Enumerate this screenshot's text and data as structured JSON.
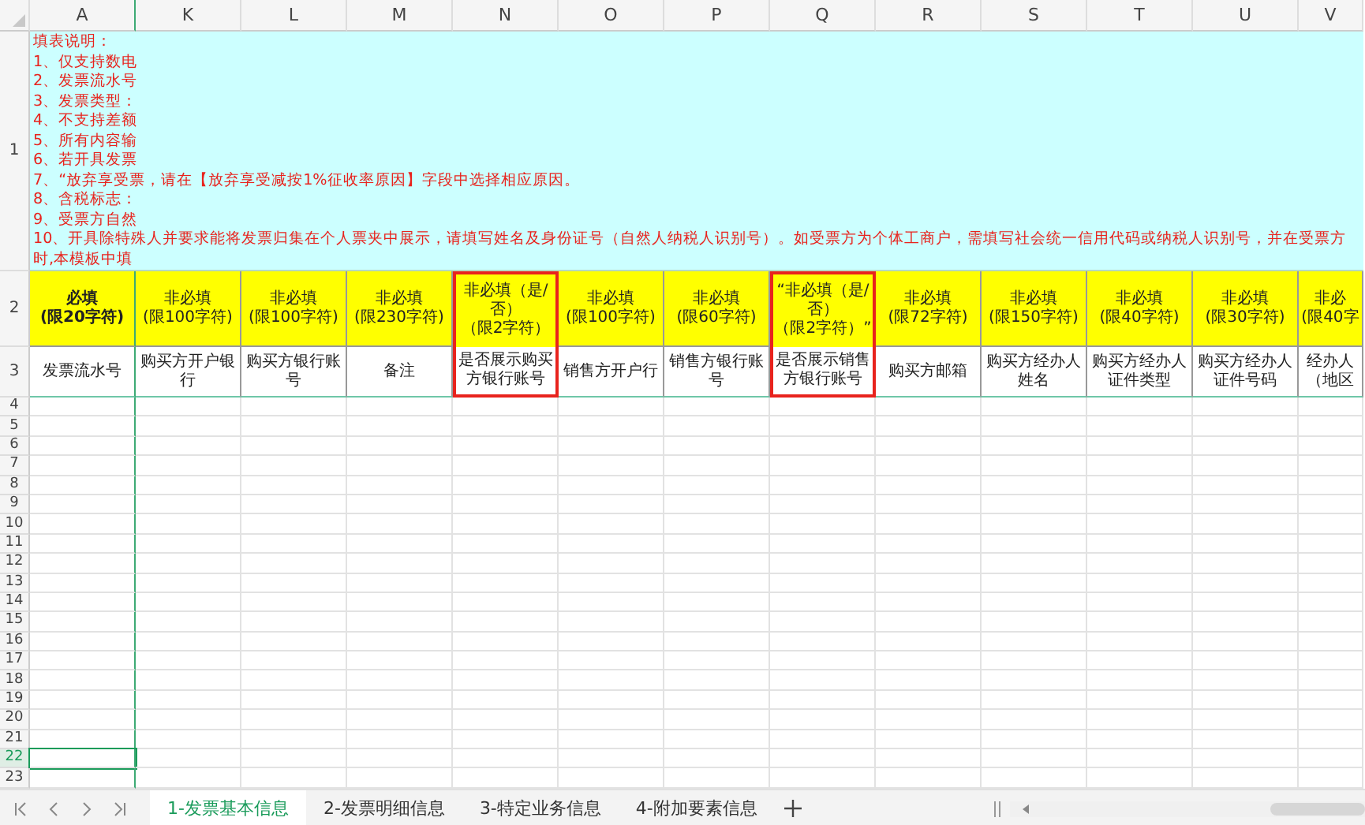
{
  "notes": {
    "title": "填表说明：",
    "lines": [
      "1、仅支持数电",
      "2、发票流水号",
      "3、发票类型：",
      "4、不支持差额",
      "5、所有内容输",
      "6、若开具发票",
      "7、“放弃享受票，请在【放弃享受减按1%征收率原因】字段中选择相应原因。",
      "8、含税标志：",
      "9、受票方自然",
      "10、开具除特殊人并要求能将发票归集在个人票夹中展示，请填写姓名及身份证号（自然人纳税人识别号）。如受票方为个体工商户，需填写社会统一信用代码或纳税人识别号，并在受票方",
      "时,本模板中填"
    ]
  },
  "columns": [
    {
      "letter": "A",
      "requirement": [
        "必填",
        "(限20字符)"
      ],
      "bold": true,
      "field": [
        "发票流水号"
      ],
      "highlighted": false
    },
    {
      "letter": "K",
      "requirement": [
        "非必填",
        "(限100字符)"
      ],
      "bold": false,
      "field": [
        "购买方开户银",
        "行"
      ],
      "highlighted": false
    },
    {
      "letter": "L",
      "requirement": [
        "非必填",
        "(限100字符)"
      ],
      "bold": false,
      "field": [
        "购买方银行账",
        "号"
      ],
      "highlighted": false
    },
    {
      "letter": "M",
      "requirement": [
        "非必填",
        "(限230字符)"
      ],
      "bold": false,
      "field": [
        "备注"
      ],
      "highlighted": false
    },
    {
      "letter": "N",
      "requirement": [
        "非必填（是/",
        "否）",
        "（限2字符）"
      ],
      "bold": false,
      "field": [
        "是否展示购买",
        "方银行账号"
      ],
      "highlighted": true
    },
    {
      "letter": "O",
      "requirement": [
        "非必填",
        "(限100字符)"
      ],
      "bold": false,
      "field": [
        "销售方开户行"
      ],
      "highlighted": false
    },
    {
      "letter": "P",
      "requirement": [
        "非必填",
        "(限60字符)"
      ],
      "bold": false,
      "field": [
        "销售方银行账",
        "号"
      ],
      "highlighted": false
    },
    {
      "letter": "Q",
      "requirement": [
        "“非必填（是/",
        "否）",
        "（限2字符）”"
      ],
      "bold": false,
      "field": [
        "是否展示销售",
        "方银行账号"
      ],
      "highlighted": true
    },
    {
      "letter": "R",
      "requirement": [
        "非必填",
        "(限72字符)"
      ],
      "bold": false,
      "field": [
        "购买方邮箱"
      ],
      "highlighted": false
    },
    {
      "letter": "S",
      "requirement": [
        "非必填",
        "(限150字符)"
      ],
      "bold": false,
      "field": [
        "购买方经办人",
        "姓名"
      ],
      "highlighted": false
    },
    {
      "letter": "T",
      "requirement": [
        "非必填",
        "(限40字符)"
      ],
      "bold": false,
      "field": [
        "购买方经办人",
        "证件类型"
      ],
      "highlighted": false
    },
    {
      "letter": "U",
      "requirement": [
        "非必填",
        "(限30字符)"
      ],
      "bold": false,
      "field": [
        "购买方经办人",
        "证件号码"
      ],
      "highlighted": false
    },
    {
      "letter": "V",
      "requirement": [
        "非必",
        "(限40字"
      ],
      "bold": false,
      "field": [
        "经办人",
        "（地区"
      ],
      "highlighted": false
    }
  ],
  "header_rows": [
    "1",
    "2",
    "3"
  ],
  "rows": [
    {
      "number": "4",
      "selected": false
    },
    {
      "number": "5",
      "selected": false
    },
    {
      "number": "6",
      "selected": false
    },
    {
      "number": "7",
      "selected": false
    },
    {
      "number": "8",
      "selected": false
    },
    {
      "number": "9",
      "selected": false
    },
    {
      "number": "10",
      "selected": false
    },
    {
      "number": "11",
      "selected": false
    },
    {
      "number": "12",
      "selected": false
    },
    {
      "number": "13",
      "selected": false
    },
    {
      "number": "14",
      "selected": false
    },
    {
      "number": "15",
      "selected": false
    },
    {
      "number": "16",
      "selected": false
    },
    {
      "number": "17",
      "selected": false
    },
    {
      "number": "18",
      "selected": false
    },
    {
      "number": "19",
      "selected": false
    },
    {
      "number": "20",
      "selected": false
    },
    {
      "number": "21",
      "selected": false
    },
    {
      "number": "22",
      "selected": true
    },
    {
      "number": "23",
      "selected": false
    }
  ],
  "sheet_tabs": [
    {
      "label": "1-发票基本信息",
      "selected": true
    },
    {
      "label": "2-发票明细信息",
      "selected": false
    },
    {
      "label": "3-特定业务信息",
      "selected": false
    },
    {
      "label": "4-附加要素信息",
      "selected": false
    }
  ]
}
